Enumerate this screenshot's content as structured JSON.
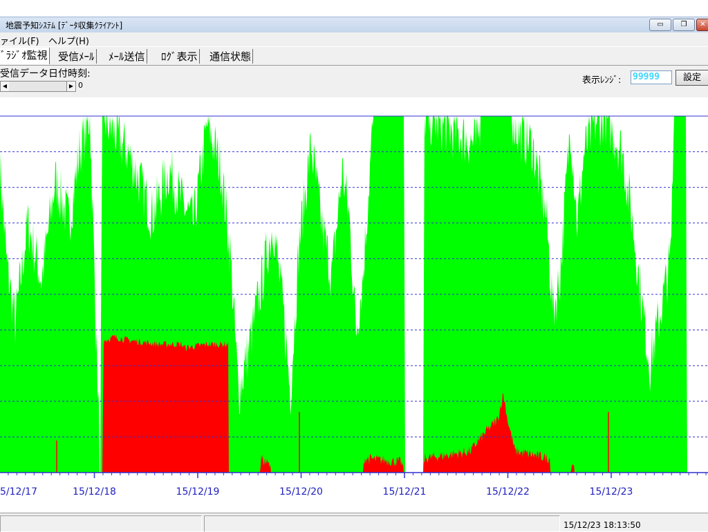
{
  "window": {
    "title": "地震予知ｼｽﾃﾑ [ﾃﾞｰﾀ収集ｸﾗｲｱﾝﾄ]",
    "minimize_glyph": "▭",
    "restore_glyph": "❐",
    "close_glyph": "✕"
  },
  "menu": [
    {
      "label": "ァイル(F)"
    },
    {
      "label": "ヘルプ(H)"
    }
  ],
  "tabs": [
    {
      "label": "ﾞﾗｼﾞｵ監視",
      "active": true
    },
    {
      "label": "受信ﾒｰﾙ",
      "active": false
    },
    {
      "label": "ﾒｰﾙ送信",
      "active": false
    },
    {
      "label": "ﾛｸﾞ表示",
      "active": false
    },
    {
      "label": "通信状態",
      "active": false
    }
  ],
  "controls": {
    "date_label": "受信データ日付時刻:",
    "scroll_value": "0",
    "scroll_left_glyph": "◀",
    "scroll_right_glyph": "▶",
    "range_label": "表示ﾚﾝｼﾞ:",
    "range_value": "99999",
    "set_button": "設定"
  },
  "chart_data": {
    "type": "area",
    "x_tick_labels": [
      "5/12/17",
      "15/12/18",
      "15/12/19",
      "15/12/20",
      "15/12/21",
      "15/12/22",
      "15/12/23"
    ],
    "ylim": [
      0,
      99999
    ],
    "grid": true,
    "series": [
      {
        "color": "#00ff00"
      },
      {
        "color": "#ff0000"
      }
    ],
    "colors": {
      "grid": "#3030d0",
      "axis": "#3030d0",
      "tick_label": "#2020c0"
    }
  },
  "status": {
    "timestamp": "15/12/23 18:13:50"
  }
}
